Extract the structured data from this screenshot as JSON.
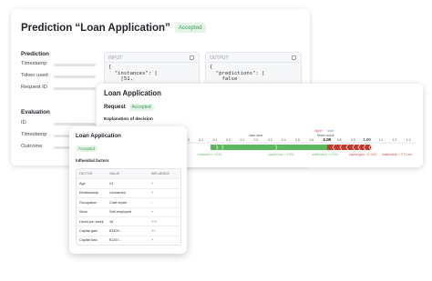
{
  "back": {
    "title": "Prediction “Loan Application”",
    "status": "Accepted",
    "prediction_label": "Prediction",
    "prediction_fields": [
      "Timestamp",
      "Token used",
      "Request ID"
    ],
    "evaluation_label": "Evaluation",
    "evaluation_fields": [
      "ID",
      "Timestamp",
      "Outcome"
    ],
    "input_header": "INPUT",
    "input_lines": [
      "{",
      "  \"instances\": [",
      "    [51,"
    ],
    "output_header": "OUTPUT",
    "output_lines": [
      "{",
      "  \"predictions\": [",
      "    false"
    ]
  },
  "mid": {
    "title": "Loan Application",
    "request_label": "Request",
    "status": "Accepted",
    "explanation_label": "Explanation of decision"
  },
  "force_plot": {
    "legend_higher": "higher",
    "legend_lower": "lower",
    "base_label": "base value",
    "model_output_label": "Model output",
    "model_output_value": "1.00",
    "ticks": [
      "-0.3",
      "-0.2",
      "-0.1",
      "0.0",
      "0.1",
      "0.2",
      "0.3",
      "0.4",
      "0.5",
      "0.6",
      "0.7",
      "0.8",
      "0.9",
      "1.00",
      "1.1",
      "1.2",
      "1.3"
    ],
    "colors": {
      "positive": "#c0392b",
      "negative": "#5cb85c"
    },
    "labels": [
      {
        "text": "education = 13.00",
        "color": "#6fbf73"
      },
      {
        "text": "capital.loss = 0.000",
        "color": "#6fbf73"
      },
      {
        "text": "relationship = 0.000",
        "color": "#6fbf73"
      },
      {
        "text": "capital.gain = 0.1410",
        "color": "#d9534f"
      },
      {
        "text": "relationship = 2.71",
        "color": "#d9534f"
      },
      {
        "text": "sex",
        "color": "#d9534f"
      }
    ]
  },
  "front": {
    "title": "Loan Application",
    "status": "Accepted",
    "influential_label": "Influential factors",
    "columns": [
      "FACTOR",
      "VALUE",
      "INFLUENCE"
    ],
    "rows": [
      [
        "Age",
        "24",
        "+"
      ],
      [
        "Relationship",
        "Unmarried",
        "+"
      ],
      [
        "Occupation",
        "Craft repair",
        "-"
      ],
      [
        "Work",
        "Self-employed",
        "+"
      ],
      [
        "Hours per week",
        "16",
        "+++"
      ],
      [
        "Capital gain",
        "€3309...",
        "++"
      ],
      [
        "Capital loss",
        "€1267...",
        "+"
      ]
    ]
  }
}
